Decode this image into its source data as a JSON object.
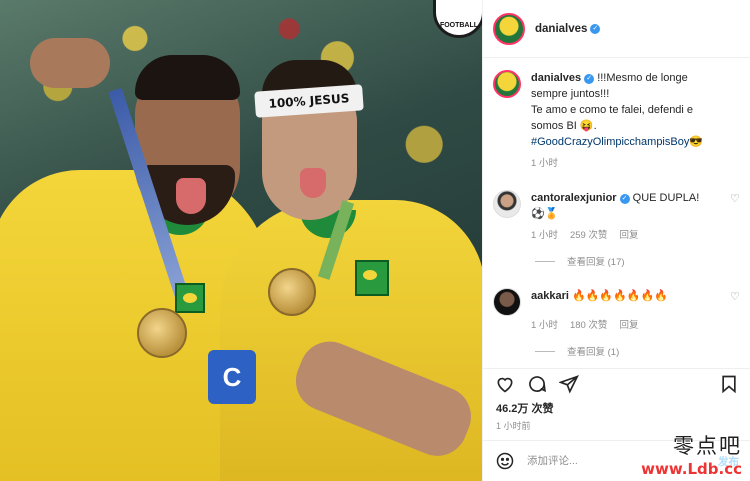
{
  "photo": {
    "headband_text": "100% JESUS",
    "armband_letter": "C",
    "logo_text": "FOOTBALL"
  },
  "header": {
    "username": "danialves",
    "verified": true
  },
  "caption": {
    "username": "danialves",
    "text_line1": " !!!Mesmo de longe",
    "text_line2": "sempre juntos!!!",
    "text_line3": "Te amo e como te falei, defendi e",
    "text_line4": "somos BI 😝.",
    "hashtag": "#GoodCrazyOlimpicchampisBoy",
    "hashtag_emoji": "😎",
    "time": "1 小时"
  },
  "comments": [
    {
      "username": "cantoralexjunior",
      "verified": true,
      "text": " QUE DUPLA!",
      "text_line2": "⚽🏅",
      "time": "1 小时",
      "likes": "259 次赞",
      "reply_label": "回复",
      "view_replies": "查看回复 (17)"
    },
    {
      "username": "aakkari",
      "verified": false,
      "text": " 🔥🔥🔥🔥🔥🔥🔥",
      "time": "1 小时",
      "likes": "180 次赞",
      "reply_label": "回复",
      "view_replies": "查看回复 (1)"
    }
  ],
  "actions": {
    "like_icon": "heart-icon",
    "comment_icon": "comment-icon",
    "share_icon": "send-icon",
    "save_icon": "bookmark-icon"
  },
  "likes_count": "46.2万 次赞",
  "post_time": "1 小时前",
  "add_comment": {
    "placeholder": "添加评论...",
    "post_label": "发布"
  },
  "watermark": {
    "chinese": "零点吧",
    "url": "www.Ldb.cc"
  }
}
